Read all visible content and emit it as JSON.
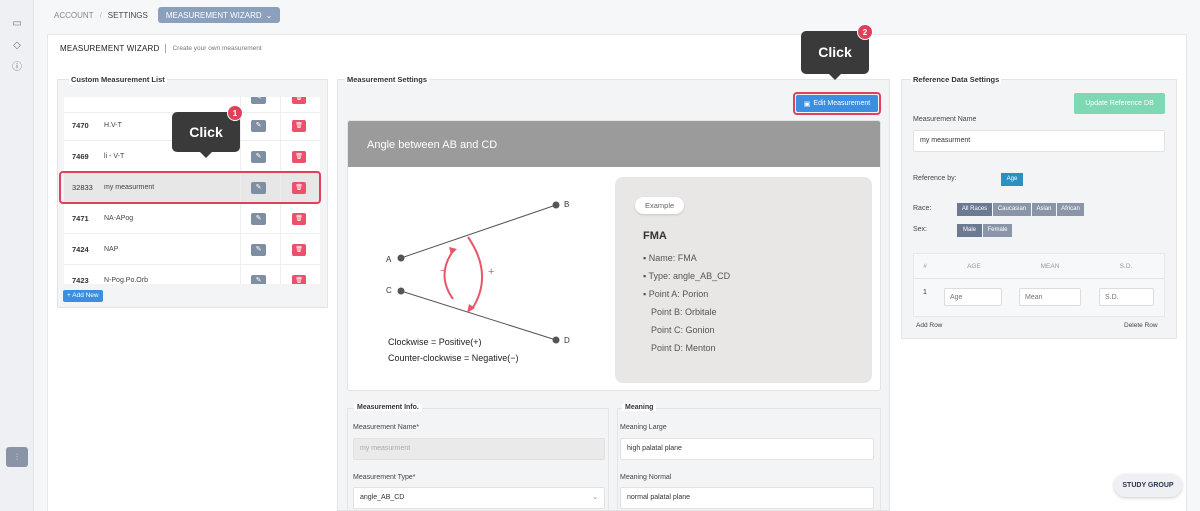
{
  "breadcrumb": {
    "account": "ACCOUNT",
    "settings": "SETTINGS",
    "wizard": "MEASUREMENT WIZARD"
  },
  "header": {
    "title": "MEASUREMENT WIZARD",
    "subtitle": "Create your own measurement"
  },
  "list_panel": {
    "title": "Custom Measurement List",
    "rows": [
      {
        "id": "7470",
        "name": "H.V-T"
      },
      {
        "id": "7469",
        "name": "li - V-T"
      },
      {
        "id": "32833",
        "name": "my measurment"
      },
      {
        "id": "7471",
        "name": "NA-APog"
      },
      {
        "id": "7424",
        "name": "NAP"
      },
      {
        "id": "7423",
        "name": "N-Pog.Po.Orb"
      }
    ],
    "add_new": "+ Add New"
  },
  "tooltips": {
    "t1": {
      "text": "Click",
      "num": "1"
    },
    "t2": {
      "text": "Click",
      "num": "2"
    }
  },
  "settings_panel": {
    "title": "Measurement Settings",
    "edit_btn": "Edit Measurement",
    "diagram_title": "Angle between AB and CD",
    "points": {
      "a": "A",
      "b": "B",
      "c": "C",
      "d": "D"
    },
    "signs": {
      "minus": "−",
      "plus": "+"
    },
    "clockwise": "Clockwise = Positive(+)",
    "counter_clockwise": "Counter-clockwise = Negative(−)",
    "example": {
      "pill": "Example",
      "title": "FMA",
      "lines": [
        "Name: FMA",
        "Type: angle_AB_CD",
        "Point A: Porion",
        "Point B: Orbitale",
        "Point C: Gonion",
        "Point D: Menton"
      ]
    }
  },
  "info": {
    "title": "Measurement Info.",
    "name_label": "Measurement Name*",
    "name_value": "my measurment",
    "type_label": "Measurement Type*",
    "type_value": "angle_AB_CD"
  },
  "meaning": {
    "title": "Meaning",
    "large_label": "Meaning Large",
    "large_value": "high palatal plane",
    "normal_label": "Meaning Normal",
    "normal_value": "normal palatal plane"
  },
  "reference": {
    "title": "Reference Data Settings",
    "update_btn": "Update Reference DB",
    "name_label": "Measurement Name",
    "name_value": "my measurment",
    "ref_by_label": "Reference by:",
    "ref_by_tag": "Age",
    "race_label": "Race:",
    "races": [
      "All Races",
      "Caucasian",
      "Asian",
      "African"
    ],
    "sex_label": "Sex:",
    "sexes": [
      "Male",
      "Female"
    ],
    "table_headers": [
      "#",
      "AGE",
      "MEAN",
      "S.D."
    ],
    "row_num": "1",
    "placeholders": {
      "age": "Age",
      "mean": "Mean",
      "sd": "S.D."
    },
    "add_row": "Add Row",
    "delete_row": "Delete Row"
  },
  "study_group": "STUDY GROUP"
}
